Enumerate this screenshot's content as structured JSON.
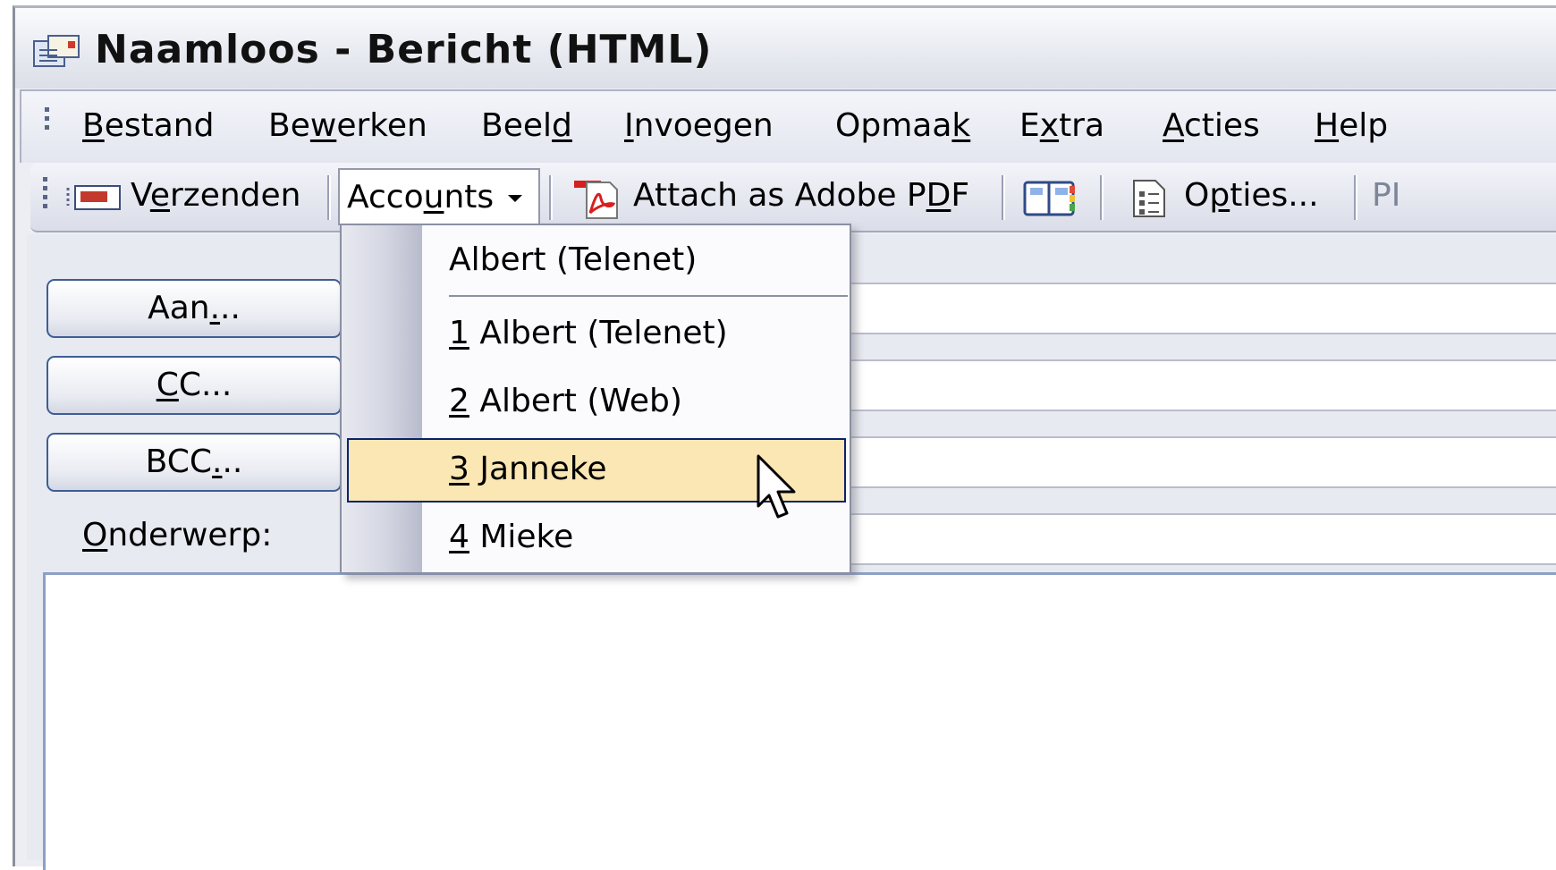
{
  "window": {
    "title": "Naamloos - Bericht (HTML)",
    "icon": "message-icon"
  },
  "menubar": {
    "items": [
      {
        "pre": "",
        "key": "B",
        "post": "estand"
      },
      {
        "pre": "Be",
        "key": "w",
        "post": "erken"
      },
      {
        "pre": "Beel",
        "key": "d",
        "post": ""
      },
      {
        "pre": "",
        "key": "I",
        "post": "nvoegen"
      },
      {
        "pre": "Opmaa",
        "key": "k",
        "post": ""
      },
      {
        "pre": "E",
        "key": "x",
        "post": "tra"
      },
      {
        "pre": "",
        "key": "A",
        "post": "cties"
      },
      {
        "pre": "",
        "key": "H",
        "post": "elp"
      }
    ]
  },
  "toolbar": {
    "send": {
      "pre": "V",
      "key": "e",
      "post": "rzenden",
      "icon": "send-envelope-icon"
    },
    "accounts": {
      "pre": "Acco",
      "key": "u",
      "post": "nts",
      "icon": "dropdown-arrow-icon"
    },
    "adobe": {
      "pre": "Attach as Adobe P",
      "key": "D",
      "post": "F",
      "icon": "adobe-pdf-icon"
    },
    "addressbook_icon": "address-book-icon",
    "options": {
      "pre": "O",
      "key": "p",
      "post": "ties...",
      "icon": "options-icon"
    },
    "overflow": "PI"
  },
  "form": {
    "to": {
      "pre": "Aan",
      "key": ".",
      "post": ".."
    },
    "cc": {
      "pre": "",
      "key": "C",
      "post": "C..."
    },
    "bcc": {
      "pre": "BCC",
      "key": ".",
      "post": ".."
    },
    "subject": {
      "pre": "",
      "key": "O",
      "post": "nderwerp:"
    }
  },
  "accounts_menu": {
    "current": "Albert (Telenet)",
    "items": [
      {
        "key": "1",
        "label": " Albert (Telenet)"
      },
      {
        "key": "2",
        "label": " Albert (Web)"
      },
      {
        "key": "3",
        "label": " Janneke"
      },
      {
        "key": "4",
        "label": " Mieke"
      }
    ],
    "highlighted_index": 2
  },
  "colors": {
    "highlight_fill": "#fbe7b3",
    "highlight_border": "#0a246a",
    "button_border": "#3f5d95"
  }
}
